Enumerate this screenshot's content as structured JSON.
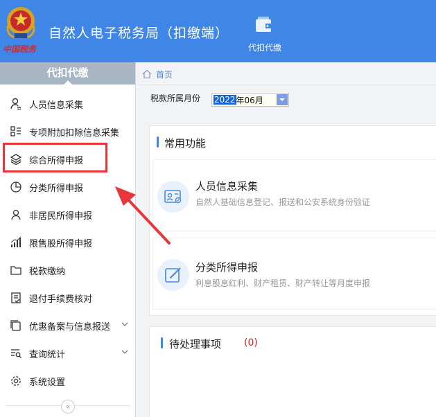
{
  "app": {
    "title": "自然人电子税务局（扣缴端）",
    "emblem_text": "中国税务",
    "active_tab": {
      "label": "代扣代缴",
      "icon": "wallet-icon"
    }
  },
  "sidebar": {
    "header": "代扣代缴",
    "items": [
      {
        "label": "人员信息采集",
        "icon": "person-info-icon"
      },
      {
        "label": "专项附加扣除信息采集",
        "icon": "list-grid-icon"
      },
      {
        "label": "综合所得申报",
        "icon": "layers-icon",
        "highlighted": true
      },
      {
        "label": "分类所得申报",
        "icon": "pie-chart-icon"
      },
      {
        "label": "非居民所得申报",
        "icon": "person-icon"
      },
      {
        "label": "限售股所得申报",
        "icon": "bar-chart-icon"
      },
      {
        "label": "税款缴纳",
        "icon": "folder-icon"
      },
      {
        "label": "退付手续费核对",
        "icon": "document-check-icon"
      },
      {
        "label": "优惠备案与信息报送",
        "icon": "copy-icon",
        "expandable": true
      },
      {
        "label": "查询统计",
        "icon": "search-list-icon",
        "expandable": true
      },
      {
        "label": "系统设置",
        "icon": "gear-icon"
      }
    ],
    "collapse_symbol": "«"
  },
  "breadcrumb": {
    "home_label": "首页"
  },
  "filter": {
    "label": "税款所属月份",
    "month_selected": "2022",
    "month_rest": "年06月"
  },
  "common_functions": {
    "title": "常用功能",
    "cards": [
      {
        "title": "人员信息采集",
        "desc": "自然人基础信息登记、报送和公安系统身份验证",
        "icon": "id-card-icon"
      },
      {
        "title": "分类所得申报",
        "desc": "利息股息红利、财产租赁、财产转让等月度申报",
        "icon": "edit-icon"
      }
    ]
  },
  "pending": {
    "title": "待处理事项",
    "count": "(0)"
  },
  "colors": {
    "header_blue": "#3f86e6",
    "highlight_red": "#e8363a",
    "sidebar_header": "#a8b5c4"
  }
}
